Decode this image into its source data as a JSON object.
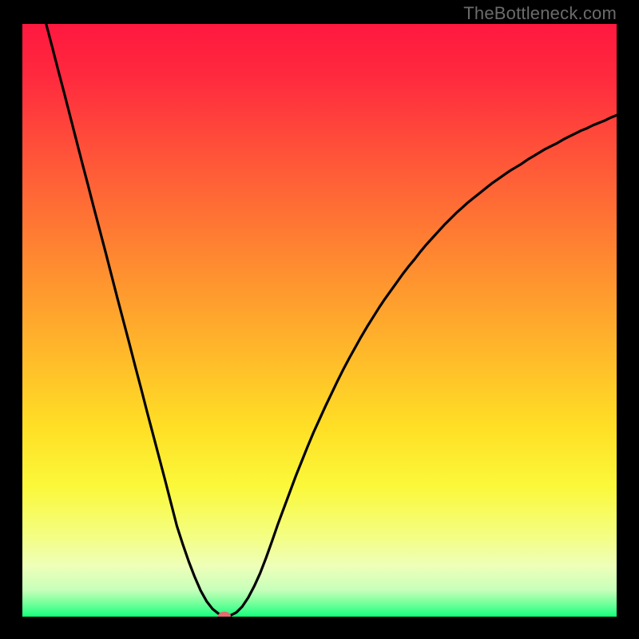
{
  "watermark": "TheBottleneck.com",
  "colors": {
    "page_bg": "#000000",
    "gradient_stops": [
      {
        "offset": 0.0,
        "color": "#ff183f"
      },
      {
        "offset": 0.09,
        "color": "#ff2a3e"
      },
      {
        "offset": 0.2,
        "color": "#ff4d3a"
      },
      {
        "offset": 0.32,
        "color": "#ff7134"
      },
      {
        "offset": 0.44,
        "color": "#ff962f"
      },
      {
        "offset": 0.56,
        "color": "#ffba2a"
      },
      {
        "offset": 0.68,
        "color": "#ffdf25"
      },
      {
        "offset": 0.78,
        "color": "#fbf83a"
      },
      {
        "offset": 0.86,
        "color": "#f4fe7e"
      },
      {
        "offset": 0.915,
        "color": "#eeffb9"
      },
      {
        "offset": 0.955,
        "color": "#c7ffba"
      },
      {
        "offset": 0.98,
        "color": "#6bff98"
      },
      {
        "offset": 1.0,
        "color": "#14ff7b"
      }
    ],
    "curve": "#000000",
    "marker": "#e46a6f",
    "watermark_text": "#6b6b6b"
  },
  "chart_data": {
    "type": "line",
    "title": "",
    "xlabel": "",
    "ylabel": "",
    "xlim": [
      0,
      100
    ],
    "ylim": [
      0,
      100
    ],
    "x": [
      4,
      5,
      6,
      7,
      8,
      9,
      10,
      11,
      12,
      13,
      14,
      15,
      16,
      17,
      18,
      19,
      20,
      21,
      22,
      23,
      24,
      25,
      26,
      27,
      28,
      29,
      30,
      31,
      32,
      33,
      34,
      35,
      36,
      37,
      38,
      39,
      40,
      41,
      42,
      43,
      44,
      45,
      46,
      47,
      48,
      49,
      50,
      51,
      52,
      53,
      54,
      55,
      56,
      57,
      58,
      59,
      60,
      61,
      62,
      63,
      64,
      65,
      66,
      67,
      68,
      69,
      70,
      71,
      72,
      73,
      74,
      75,
      76,
      77,
      78,
      79,
      80,
      81,
      82,
      83,
      84,
      85,
      86,
      87,
      88,
      89,
      90,
      91,
      92,
      93,
      94,
      95,
      96,
      97,
      98,
      99,
      100
    ],
    "y": [
      100,
      96.2,
      92.3,
      88.5,
      84.6,
      80.7,
      76.8,
      73,
      69.1,
      65.3,
      61.5,
      57.6,
      53.7,
      49.9,
      46.1,
      42.2,
      38.4,
      34.5,
      30.7,
      26.9,
      23.1,
      19.2,
      15.3,
      12.2,
      9.3,
      6.7,
      4.4,
      2.6,
      1.3,
      0.5,
      0.1,
      0.2,
      0.7,
      1.7,
      3.2,
      5.1,
      7.3,
      9.9,
      12.7,
      15.6,
      18.3,
      21,
      23.7,
      26.2,
      28.7,
      31.1,
      33.3,
      35.5,
      37.6,
      39.7,
      41.7,
      43.6,
      45.4,
      47.2,
      48.9,
      50.5,
      52.1,
      53.6,
      55,
      56.4,
      57.8,
      59.1,
      60.3,
      61.6,
      62.8,
      63.9,
      65,
      66.1,
      67.1,
      68.1,
      69,
      69.9,
      70.7,
      71.5,
      72.3,
      73.1,
      73.8,
      74.5,
      75.2,
      75.8,
      76.4,
      77.1,
      77.7,
      78.3,
      78.9,
      79.4,
      79.9,
      80.5,
      81,
      81.5,
      82,
      82.4,
      82.9,
      83.3,
      83.7,
      84.2,
      84.6
    ],
    "marker": {
      "x": 34,
      "y": 0.1
    },
    "notes": "V-shaped bottleneck curve over a vertical red-to-green gradient background. Axes are unlabeled and unticked; values are read in percent of each axis (0–100)."
  }
}
